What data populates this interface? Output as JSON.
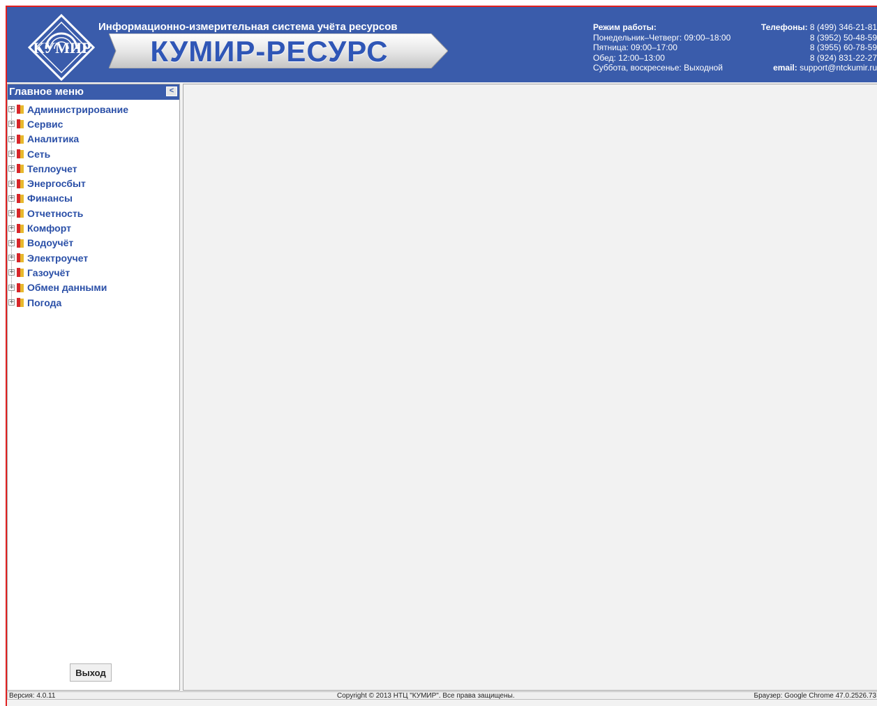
{
  "header": {
    "logo_text": "КУМИР",
    "subtitle": "Информационно-измерительная система учёта ресурсов",
    "banner_title": "КУМИР-РЕСУРС",
    "schedule": {
      "title": "Режим работы:",
      "line1": "Понедельник–Четверг: 09:00–18:00",
      "line2": "Пятница: 09:00–17:00",
      "line3": "Обед: 12:00–13:00",
      "line4": "Суббота, воскресенье: Выходной"
    },
    "contacts": {
      "phones_label": "Телефоны:",
      "phone1": "8 (499) 346-21-81",
      "phone2": "8 (3952) 50-48-59",
      "phone3": "8 (3955) 60-78-59",
      "phone4": "8 (924) 831-22-27",
      "email_label": "email:",
      "email": "support@ntckumir.ru"
    }
  },
  "sidebar": {
    "title": "Главное меню",
    "collapse_glyph": "<",
    "items": [
      {
        "label": "Администрирование"
      },
      {
        "label": "Сервис"
      },
      {
        "label": "Аналитика"
      },
      {
        "label": "Сеть"
      },
      {
        "label": "Теплоучет"
      },
      {
        "label": "Энергосбыт"
      },
      {
        "label": "Финансы"
      },
      {
        "label": "Отчетность"
      },
      {
        "label": "Комфорт"
      },
      {
        "label": "Водоучёт"
      },
      {
        "label": "Электроучет"
      },
      {
        "label": "Газоучёт"
      },
      {
        "label": "Обмен данными"
      },
      {
        "label": "Погода"
      }
    ],
    "exit_label": "Выход"
  },
  "footer": {
    "version": "Версия: 4.0.11",
    "copyright": "Copyright © 2013 НТЦ \"КУМИР\". Все права защищены.",
    "browser": "Браузер: Google Chrome 47.0.2526.73"
  },
  "colors": {
    "header_bg": "#3a5cab",
    "frame_border": "#e02020",
    "menu_text": "#2a4fa7"
  },
  "icons": {
    "tree_item": "folder-icon",
    "expander": "plus-icon",
    "collapse": "chevron-left-icon"
  }
}
